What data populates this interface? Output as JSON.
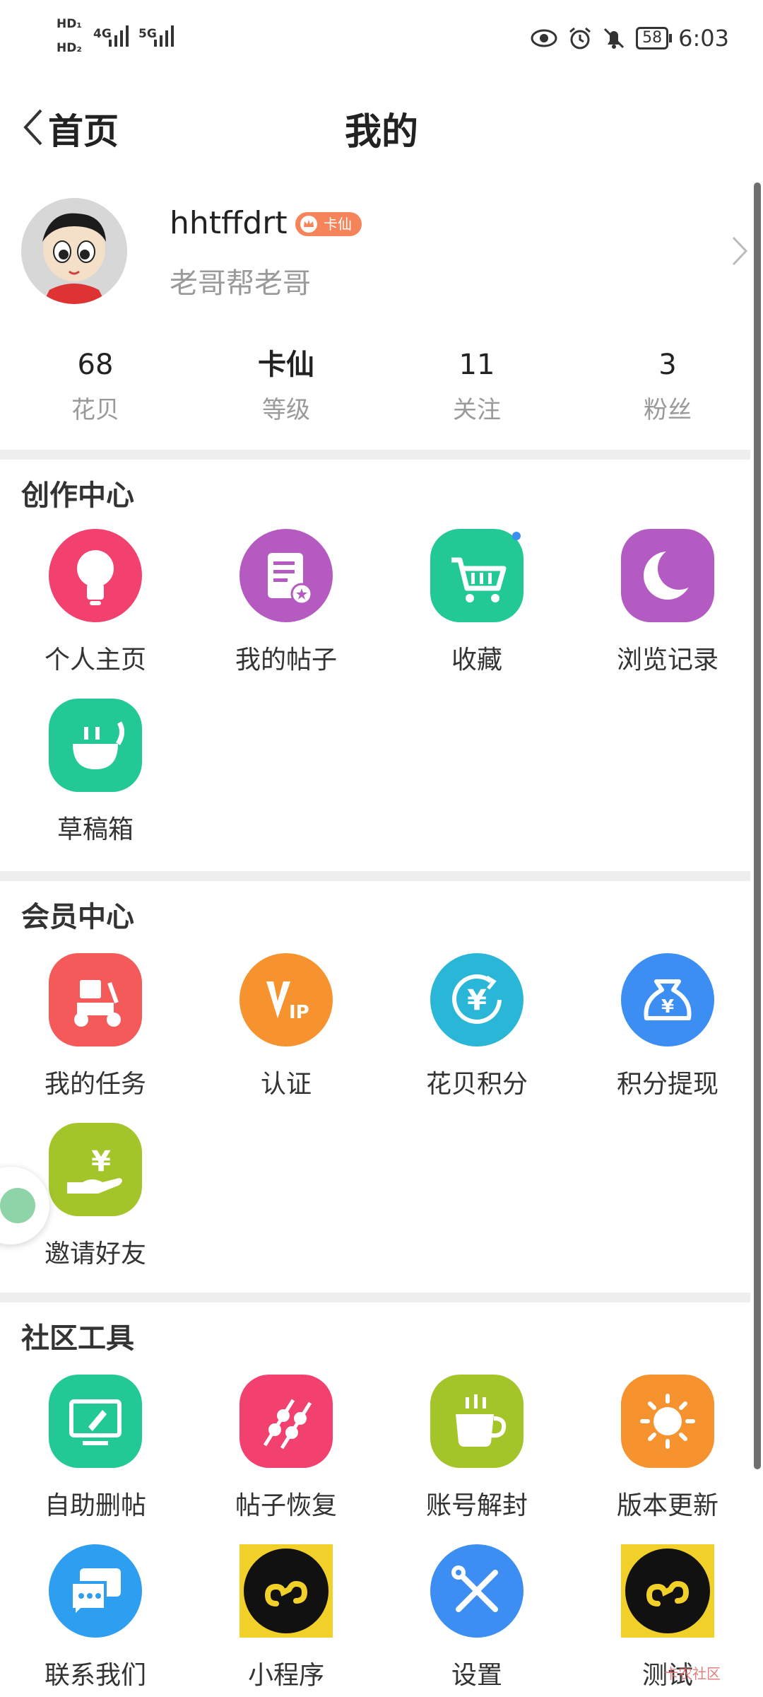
{
  "status_bar": {
    "left": {
      "hd1": "HD₁",
      "hd2": "HD₂",
      "net1": "4G",
      "net2": "5G"
    },
    "battery": "58",
    "time": "6:03"
  },
  "header": {
    "back_label": "首页",
    "title": "我的"
  },
  "profile": {
    "username": "hhtffdrt",
    "badge": "卡仙",
    "signature": "老哥帮老哥"
  },
  "stats": [
    {
      "value": "68",
      "label": "花贝"
    },
    {
      "value": "卡仙",
      "label": "等级"
    },
    {
      "value": "11",
      "label": "关注"
    },
    {
      "value": "3",
      "label": "粉丝"
    }
  ],
  "sections": [
    {
      "title": "创作中心",
      "items": [
        {
          "label": "个人主页",
          "icon": "lightbulb-icon",
          "color": "#f2416e"
        },
        {
          "label": "我的帖子",
          "icon": "document-icon",
          "color": "#b45ac1"
        },
        {
          "label": "收藏",
          "icon": "cart-icon",
          "color": "#22c994"
        },
        {
          "label": "浏览记录",
          "icon": "moon-icon",
          "color": "#b35bc2"
        },
        {
          "label": "草稿箱",
          "icon": "draft-box-icon",
          "color": "#22c994"
        }
      ]
    },
    {
      "title": "会员中心",
      "items": [
        {
          "label": "我的任务",
          "icon": "scooter-icon",
          "color": "#f45a5a"
        },
        {
          "label": "认证",
          "icon": "vip-icon",
          "color": "#f6932f"
        },
        {
          "label": "花贝积分",
          "icon": "yen-coin-icon",
          "color": "#29b6d7"
        },
        {
          "label": "积分提现",
          "icon": "money-bag-icon",
          "color": "#3d8ef2"
        },
        {
          "label": "邀请好友",
          "icon": "hand-yen-icon",
          "color": "#a4c529"
        }
      ]
    },
    {
      "title": "社区工具",
      "items": [
        {
          "label": "自助删帖",
          "icon": "monitor-edit-icon",
          "color": "#22c994"
        },
        {
          "label": "帖子恢复",
          "icon": "skewer-icon",
          "color": "#f2416e"
        },
        {
          "label": "账号解封",
          "icon": "coffee-cup-icon",
          "color": "#a4c529"
        },
        {
          "label": "版本更新",
          "icon": "sun-icon",
          "color": "#f6932f"
        },
        {
          "label": "联系我们",
          "icon": "chat-bubbles-icon",
          "color": "#2e9ef1"
        },
        {
          "label": "小程序",
          "icon": "mini-program-icon",
          "color": "#f2d02a"
        },
        {
          "label": "设置",
          "icon": "wrench-screwdriver-icon",
          "color": "#3d8ef2"
        },
        {
          "label": "测试",
          "icon": "mini-program-icon",
          "color": "#f2d02a"
        }
      ]
    }
  ],
  "watermark": "卡农社区"
}
